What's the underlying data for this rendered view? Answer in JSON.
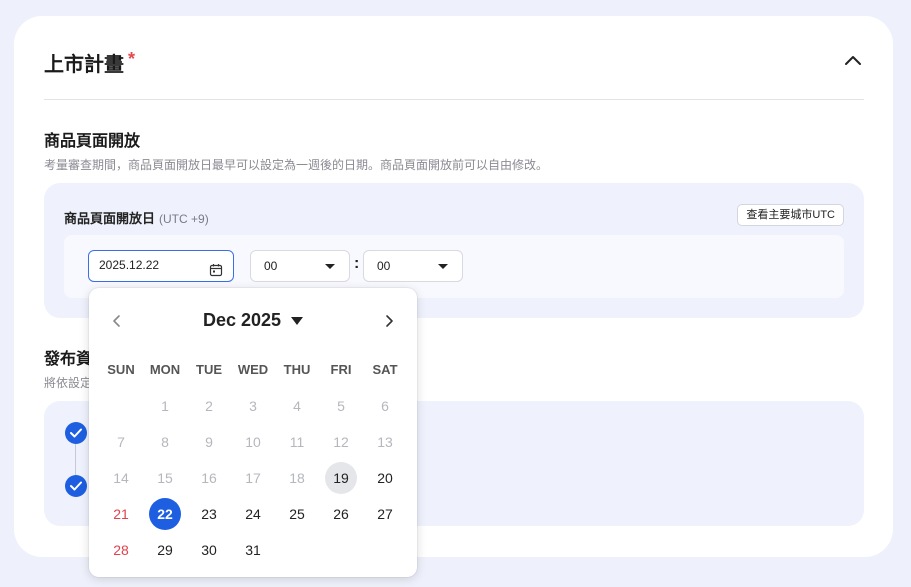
{
  "section": {
    "title": "上市計畫",
    "required_mark": "*"
  },
  "product_page": {
    "title": "商品頁面開放",
    "description": "考量審查期間，商品頁面開放日最早可以設定為一週後的日期。商品頁面開放前可以自由修改。",
    "open_date_label": "商品頁面開放日",
    "timezone": "(UTC +9)",
    "utc_button": "查看主要城市UTC",
    "date_value": "2025.12.22",
    "hour_value": "00",
    "minute_value": "00",
    "time_separator": ":"
  },
  "publish": {
    "title": "發布資",
    "description": "將依設定"
  },
  "datepicker": {
    "month_label": "Dec 2025",
    "weekdays": [
      "SUN",
      "MON",
      "TUE",
      "WED",
      "THU",
      "FRI",
      "SAT"
    ],
    "weeks": [
      [
        {
          "d": "",
          "s": "empty"
        },
        {
          "d": "1",
          "s": "disabled"
        },
        {
          "d": "2",
          "s": "disabled"
        },
        {
          "d": "3",
          "s": "disabled"
        },
        {
          "d": "4",
          "s": "disabled"
        },
        {
          "d": "5",
          "s": "disabled"
        },
        {
          "d": "6",
          "s": "disabled"
        }
      ],
      [
        {
          "d": "7",
          "s": "disabled"
        },
        {
          "d": "8",
          "s": "disabled"
        },
        {
          "d": "9",
          "s": "disabled"
        },
        {
          "d": "10",
          "s": "disabled"
        },
        {
          "d": "11",
          "s": "disabled"
        },
        {
          "d": "12",
          "s": "disabled"
        },
        {
          "d": "13",
          "s": "disabled"
        }
      ],
      [
        {
          "d": "14",
          "s": "disabled"
        },
        {
          "d": "15",
          "s": "disabled"
        },
        {
          "d": "16",
          "s": "disabled"
        },
        {
          "d": "17",
          "s": "disabled"
        },
        {
          "d": "18",
          "s": "disabled"
        },
        {
          "d": "19",
          "s": "today"
        },
        {
          "d": "20",
          "s": "active"
        }
      ],
      [
        {
          "d": "21",
          "s": "sunday"
        },
        {
          "d": "22",
          "s": "selected"
        },
        {
          "d": "23",
          "s": "active"
        },
        {
          "d": "24",
          "s": "active"
        },
        {
          "d": "25",
          "s": "active"
        },
        {
          "d": "26",
          "s": "active"
        },
        {
          "d": "27",
          "s": "active"
        }
      ],
      [
        {
          "d": "28",
          "s": "sunday"
        },
        {
          "d": "29",
          "s": "active"
        },
        {
          "d": "30",
          "s": "active"
        },
        {
          "d": "31",
          "s": "active"
        },
        {
          "d": "",
          "s": "empty"
        },
        {
          "d": "",
          "s": "empty"
        },
        {
          "d": "",
          "s": "empty"
        }
      ]
    ]
  },
  "colors": {
    "accent": "#1d5fe0",
    "required": "#e5484d",
    "panel_bg": "#eff2fd",
    "page_bg": "#eef1fb"
  },
  "icons": {
    "collapse": "chevron-up-icon",
    "calendar": "calendar-icon",
    "prev": "chevron-left-icon",
    "next": "chevron-right-icon",
    "check": "check-circle-icon"
  }
}
